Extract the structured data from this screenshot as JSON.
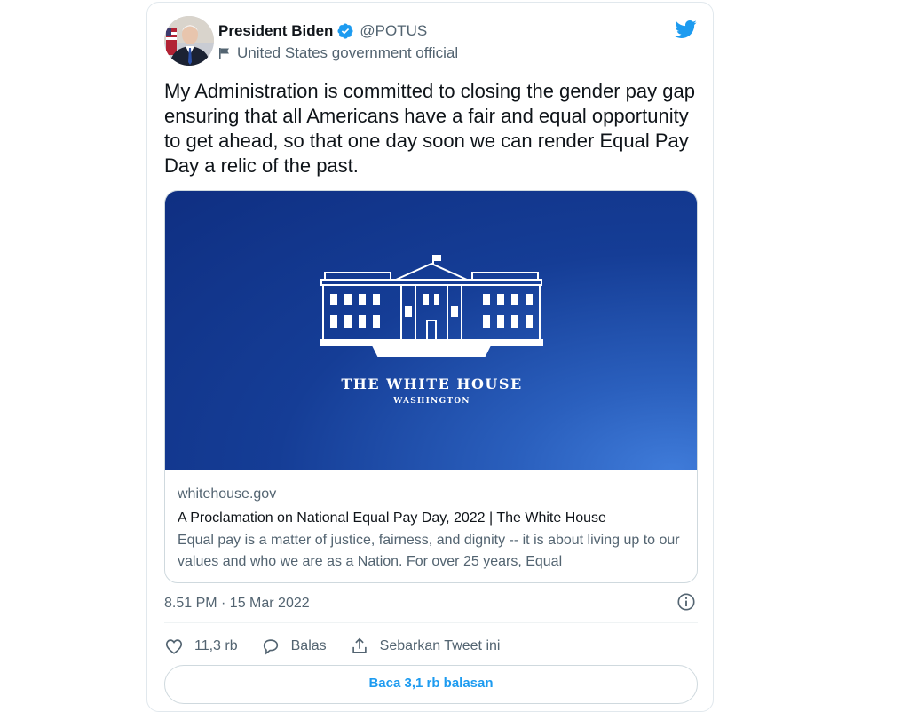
{
  "author": {
    "display_name": "President Biden",
    "handle": "@POTUS",
    "label": "United States government official",
    "avatar_icon": "person-portrait",
    "verified_icon": "verified-badge-icon"
  },
  "tweet": {
    "text": "My Administration is committed to closing the gender pay gap ensuring that all Americans have a fair and equal opportunity to get ahead, so that one day soon we can render Equal Pay Day a relic of the past."
  },
  "link_card": {
    "image_title": "THE WHITE HOUSE",
    "image_subtitle": "WASHINGTON",
    "domain": "whitehouse.gov",
    "title": "A Proclamation on National Equal Pay Day, 2022 | The White House",
    "description": "Equal pay is a matter of justice, fairness, and dignity -- it is about living up to our values and who we are as a Nation.  For over 25 years, Equal"
  },
  "meta": {
    "timestamp": "8.51 PM · 15 Mar 2022"
  },
  "actions": {
    "like_count": "11,3 rb",
    "reply_label": "Balas",
    "share_label": "Sebarkan Tweet ini"
  },
  "read_replies_label": "Baca 3,1 rb balasan",
  "colors": {
    "twitter_blue": "#1d9bf0",
    "secondary_text": "#536471",
    "border": "#cfd9de"
  }
}
